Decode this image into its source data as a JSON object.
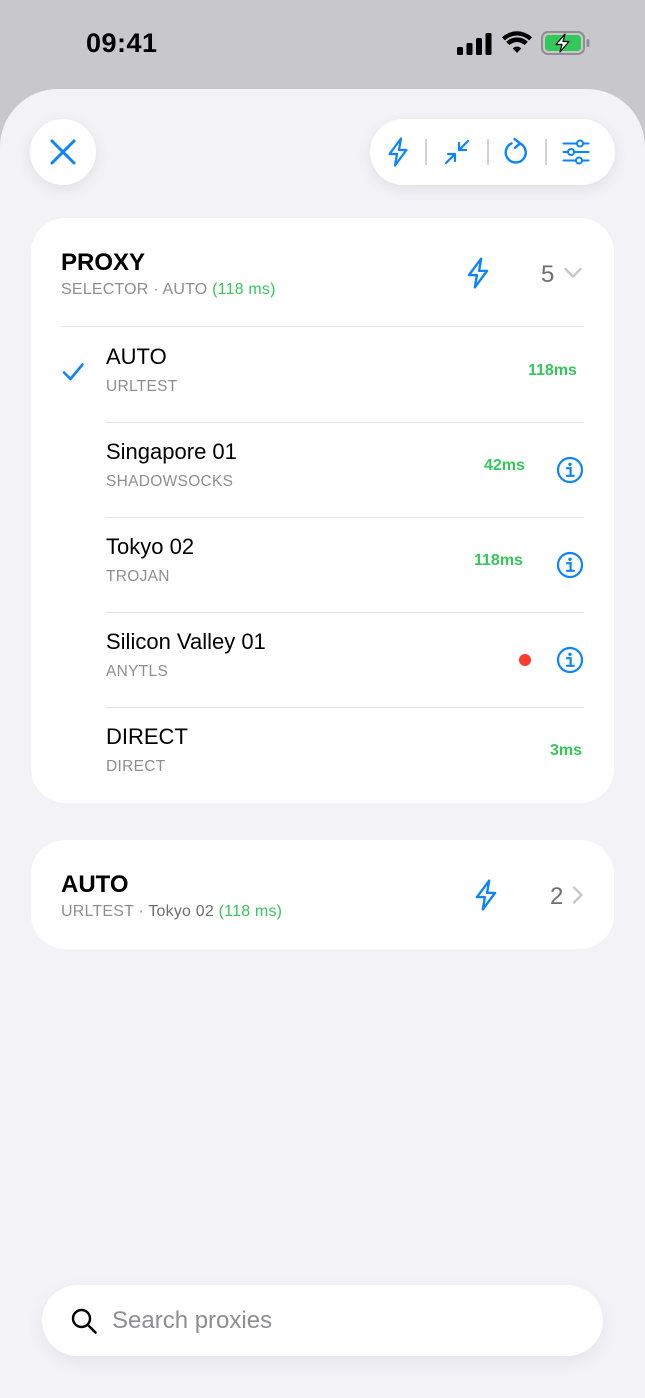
{
  "status_bar": {
    "time": "09:41",
    "icons": [
      "signal-icon",
      "wifi-icon",
      "battery-charging-icon"
    ]
  },
  "toolbar": {
    "close_icon": "close-icon",
    "actions": [
      "bolt-icon",
      "collapse-icon",
      "refresh-icon",
      "sliders-icon"
    ]
  },
  "groups": [
    {
      "title": "PROXY",
      "type": "SELECTOR",
      "selected": "AUTO",
      "latency": "(118 ms)",
      "count": "5",
      "expanded": true,
      "items": [
        {
          "name": "AUTO",
          "type": "URLTEST",
          "latency": "118ms",
          "selected": true
        },
        {
          "name": "Singapore 01",
          "type": "SHADOWSOCKS",
          "latency": "42ms"
        },
        {
          "name": "Tokyo 02",
          "type": "TROJAN",
          "latency": "118ms"
        },
        {
          "name": "Silicon Valley 01",
          "type": "ANYTLS",
          "latency": ""
        },
        {
          "name": "DIRECT",
          "type": "DIRECT",
          "latency": "3ms"
        }
      ]
    },
    {
      "title": "AUTO",
      "type": "URLTEST",
      "selected": "Tokyo 02",
      "latency": "(118 ms)",
      "count": "2",
      "expanded": false
    }
  ],
  "search": {
    "placeholder": "Search proxies",
    "value": ""
  },
  "colors": {
    "accent": "#0a84ff",
    "latency": "#34c759",
    "error": "#ff3b30"
  }
}
